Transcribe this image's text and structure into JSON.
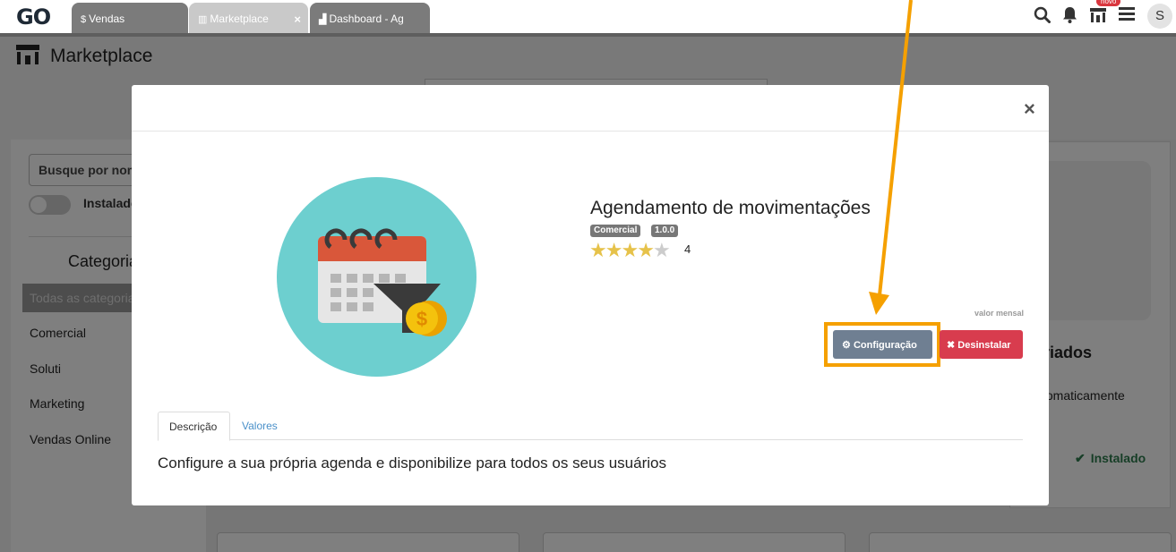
{
  "topbar": {
    "logo": "GO",
    "tabs": [
      {
        "icon": "$",
        "label": "Vendas"
      },
      {
        "icon": "store-icon",
        "label": "Marketplace",
        "close": "×"
      },
      {
        "icon": "chart-icon",
        "label": "Dashboard - Ag"
      }
    ],
    "badge_novo": "novo",
    "avatar_letter": "S"
  },
  "page": {
    "title": "Marketplace",
    "search_placeholder": "Busque por nome",
    "installed_toggle_label": "Instalados",
    "categories_title": "Categorias",
    "categories": [
      "Todas as categorias",
      "Comercial",
      "Soluti",
      "Marketing",
      "Vendas Online"
    ],
    "behind_card": {
      "heading": "riados",
      "text": "tomaticamente",
      "status": "Instalado"
    }
  },
  "modal": {
    "close": "×",
    "app_title": "Agendamento de movimentações",
    "tags": [
      "Comercial",
      "1.0.0"
    ],
    "rating": 4,
    "rating_max": 5,
    "rating_text": "4",
    "price_label": "valor mensal",
    "config_button": "Configuração",
    "uninstall_button": "Desinstalar",
    "tabs": [
      "Descrição",
      "Valores"
    ],
    "description": "Configure a sua própria agenda e disponibilize para todos os seus usuários"
  },
  "colors": {
    "highlight": "#f5a000",
    "config_button": "#6f7f92",
    "uninstall_button": "#d83c4e",
    "icon_circle": "#6dcfcf"
  }
}
